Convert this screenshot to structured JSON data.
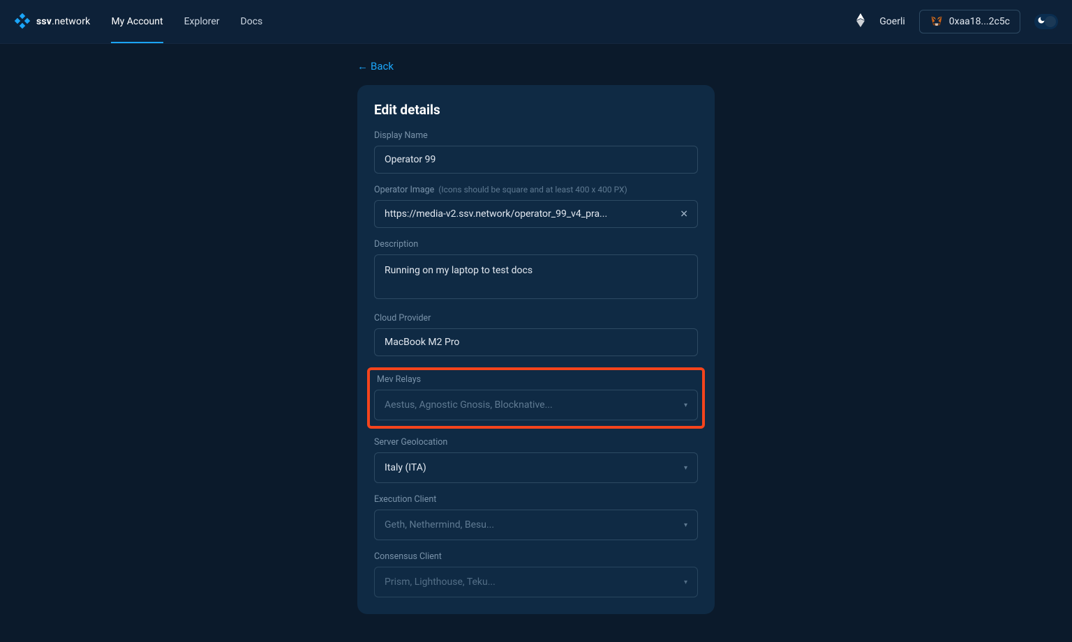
{
  "brand": {
    "name_bold": "ssv",
    "name_thin": ".network"
  },
  "nav": {
    "my_account": "My Account",
    "explorer": "Explorer",
    "docs": "Docs"
  },
  "header": {
    "network": "Goerli",
    "wallet_address": "0xaa18...2c5c"
  },
  "back": {
    "arrow": "←",
    "label": "Back"
  },
  "card": {
    "title": "Edit details"
  },
  "fields": {
    "display_name": {
      "label": "Display Name",
      "value": "Operator 99"
    },
    "operator_image": {
      "label": "Operator Image",
      "hint": "(Icons should be square and at least 400 x 400 PX)",
      "value": "https://media-v2.ssv.network/operator_99_v4_pra..."
    },
    "description": {
      "label": "Description",
      "value": "Running on my laptop to test docs"
    },
    "cloud_provider": {
      "label": "Cloud Provider",
      "value": "MacBook M2 Pro"
    },
    "mev_relays": {
      "label": "Mev Relays",
      "placeholder": "Aestus, Agnostic Gnosis, Blocknative..."
    },
    "server_geolocation": {
      "label": "Server Geolocation",
      "value": "Italy (ITA)"
    },
    "execution_client": {
      "label": "Execution Client",
      "placeholder": "Geth, Nethermind, Besu..."
    },
    "consensus_client": {
      "label": "Consensus Client",
      "placeholder": "Prism, Lighthouse, Teku..."
    }
  }
}
